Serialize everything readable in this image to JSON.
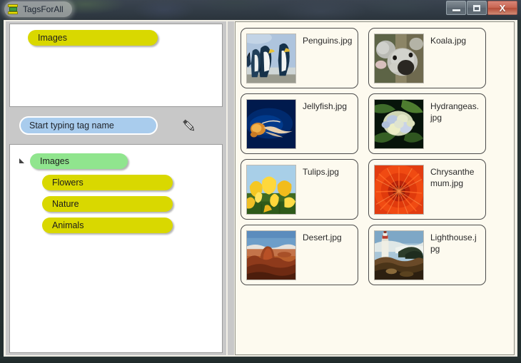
{
  "window": {
    "title": "TagsForAll",
    "app_icon": "tag-stack-icon",
    "controls": {
      "minimize_label": "–",
      "maximize_label": "□",
      "close_label": "X",
      "minimize_name": "minimize-button",
      "maximize_name": "maximize-button",
      "close_name": "close-button"
    },
    "colors": {
      "tag_yellow": "#d9d800",
      "tag_green": "#90e58e",
      "search_blue": "#a9cced",
      "panel_gray": "#c8c8c8",
      "file_panel_cream": "#fdfaef",
      "titlebar_dark": "#323c46"
    }
  },
  "left_panel": {
    "selected_tags": [
      {
        "label": "Images",
        "color": "yellow"
      }
    ],
    "search": {
      "value": "",
      "placeholder": "Start typing tag name"
    },
    "edit_icon": "pencil-icon",
    "tree": {
      "root": {
        "label": "Images",
        "color": "green",
        "expanded": true,
        "expander_icon": "triangle-expanded-icon"
      },
      "children": [
        {
          "label": "Flowers",
          "color": "yellow"
        },
        {
          "label": "Nature",
          "color": "yellow"
        },
        {
          "label": "Animals",
          "color": "yellow"
        }
      ]
    }
  },
  "file_panel": {
    "files": [
      {
        "name": "Penguins.jpg",
        "thumb": "penguins-thumbnail"
      },
      {
        "name": "Koala.jpg",
        "thumb": "koala-thumbnail"
      },
      {
        "name": "Jellyfish.jpg",
        "thumb": "jellyfish-thumbnail"
      },
      {
        "name": "Hydrangeas.jpg",
        "thumb": "hydrangeas-thumbnail"
      },
      {
        "name": "Tulips.jpg",
        "thumb": "tulips-thumbnail"
      },
      {
        "name": "Chrysanthemum.jpg",
        "thumb": "chrysanthemum-thumbnail"
      },
      {
        "name": "Desert.jpg",
        "thumb": "desert-thumbnail"
      },
      {
        "name": "Lighthouse.jpg",
        "thumb": "lighthouse-thumbnail"
      }
    ]
  }
}
